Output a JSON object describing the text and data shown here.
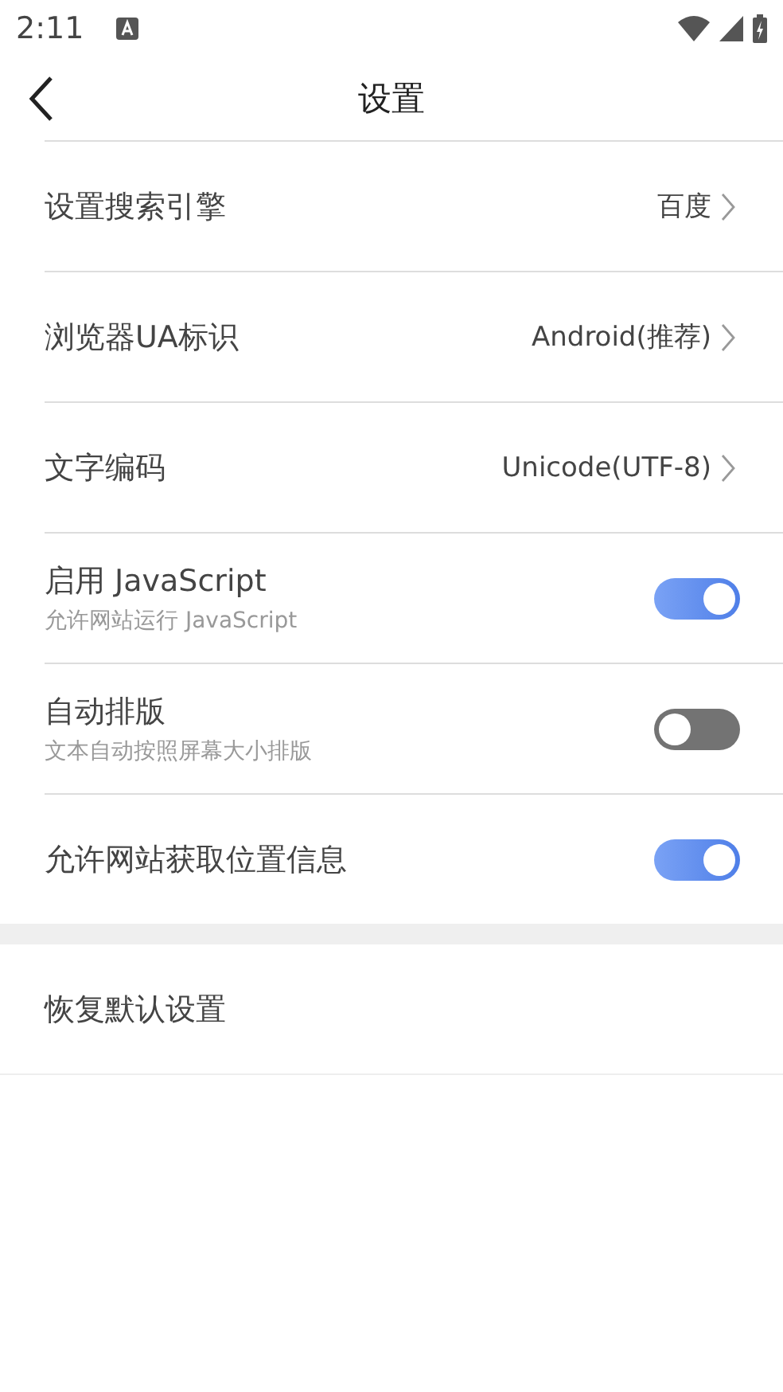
{
  "status_bar": {
    "time": "2:11"
  },
  "toolbar": {
    "title": "设置"
  },
  "settings": [
    {
      "kind": "link",
      "label": "设置搜索引擎",
      "value": "百度"
    },
    {
      "kind": "link",
      "label": "浏览器UA标识",
      "value": "Android(推荐)"
    },
    {
      "kind": "link",
      "label": "文字编码",
      "value": "Unicode(UTF-8)"
    },
    {
      "kind": "switch",
      "label": "启用 JavaScript",
      "subtitle": "允许网站运行 JavaScript",
      "on": true
    },
    {
      "kind": "switch",
      "label": "自动排版",
      "subtitle": "文本自动按照屏幕大小排版",
      "on": false
    },
    {
      "kind": "switch",
      "label": "允许网站获取位置信息",
      "on": true
    }
  ],
  "actions": [
    {
      "label": "恢复默认设置"
    }
  ]
}
